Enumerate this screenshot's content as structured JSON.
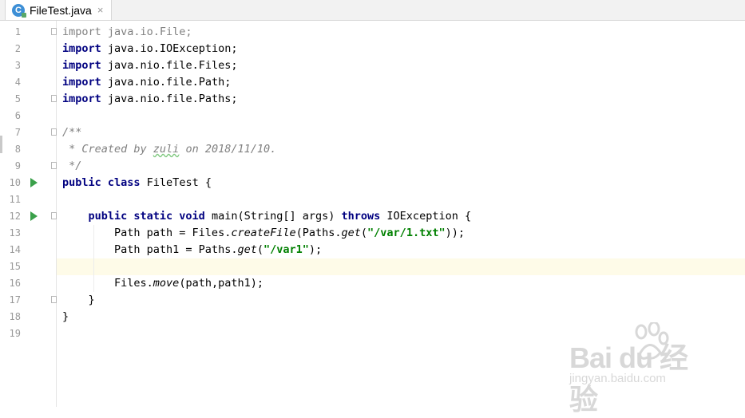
{
  "tab": {
    "filename": "FileTest.java",
    "close_symbol": "×",
    "icon": "class-icon",
    "icon_letter": "C"
  },
  "editor": {
    "current_line": 15,
    "lines": [
      {
        "num": "1",
        "tokens": [
          {
            "t": "import java.io.File;",
            "c": "dim"
          }
        ],
        "fold": true
      },
      {
        "num": "2",
        "tokens": [
          {
            "t": "import",
            "c": "kw"
          },
          {
            "t": " java.io.IOException;",
            "c": ""
          }
        ]
      },
      {
        "num": "3",
        "tokens": [
          {
            "t": "import",
            "c": "kw"
          },
          {
            "t": " java.nio.file.Files;",
            "c": ""
          }
        ]
      },
      {
        "num": "4",
        "tokens": [
          {
            "t": "import",
            "c": "kw"
          },
          {
            "t": " java.nio.file.Path;",
            "c": ""
          }
        ]
      },
      {
        "num": "5",
        "tokens": [
          {
            "t": "import",
            "c": "kw"
          },
          {
            "t": " java.nio.file.Paths;",
            "c": ""
          }
        ],
        "fold": true
      },
      {
        "num": "6",
        "tokens": []
      },
      {
        "num": "7",
        "tokens": [
          {
            "t": "/**",
            "c": "cmt"
          }
        ],
        "fold": true
      },
      {
        "num": "8",
        "tokens": [
          {
            "t": " * Created by ",
            "c": "cmt"
          },
          {
            "t": "zuli",
            "c": "cmt typo"
          },
          {
            "t": " on 2018/11/10.",
            "c": "cmt"
          }
        ]
      },
      {
        "num": "9",
        "tokens": [
          {
            "t": " */",
            "c": "cmt"
          }
        ],
        "fold": true
      },
      {
        "num": "10",
        "tokens": [
          {
            "t": "public class",
            "c": "kw"
          },
          {
            "t": " FileTest {",
            "c": ""
          }
        ],
        "run": true
      },
      {
        "num": "11",
        "tokens": []
      },
      {
        "num": "12",
        "tokens": [
          {
            "t": "    ",
            "c": ""
          },
          {
            "t": "public static void",
            "c": "kw"
          },
          {
            "t": " main(String[] args) ",
            "c": ""
          },
          {
            "t": "throws",
            "c": "kw"
          },
          {
            "t": " IOException {",
            "c": ""
          }
        ],
        "run": true,
        "fold": true
      },
      {
        "num": "13",
        "tokens": [
          {
            "t": "        Path path = Files.",
            "c": ""
          },
          {
            "t": "createFile",
            "c": "ital"
          },
          {
            "t": "(Paths.",
            "c": ""
          },
          {
            "t": "get",
            "c": "ital"
          },
          {
            "t": "(",
            "c": ""
          },
          {
            "t": "\"/var/1.txt\"",
            "c": "str"
          },
          {
            "t": "));",
            "c": ""
          }
        ]
      },
      {
        "num": "14",
        "tokens": [
          {
            "t": "        Path path1 = Paths.",
            "c": ""
          },
          {
            "t": "get",
            "c": "ital"
          },
          {
            "t": "(",
            "c": ""
          },
          {
            "t": "\"/var1\"",
            "c": "str"
          },
          {
            "t": ");",
            "c": ""
          }
        ]
      },
      {
        "num": "15",
        "tokens": []
      },
      {
        "num": "16",
        "tokens": [
          {
            "t": "        Files.",
            "c": ""
          },
          {
            "t": "move",
            "c": "ital"
          },
          {
            "t": "(path,path1);",
            "c": ""
          }
        ]
      },
      {
        "num": "17",
        "tokens": [
          {
            "t": "    }",
            "c": ""
          }
        ],
        "fold": true
      },
      {
        "num": "18",
        "tokens": [
          {
            "t": "}",
            "c": ""
          }
        ]
      },
      {
        "num": "19",
        "tokens": []
      }
    ]
  },
  "watermark": {
    "brand": "Bai du 经验",
    "url": "jingyan.baidu.com"
  }
}
